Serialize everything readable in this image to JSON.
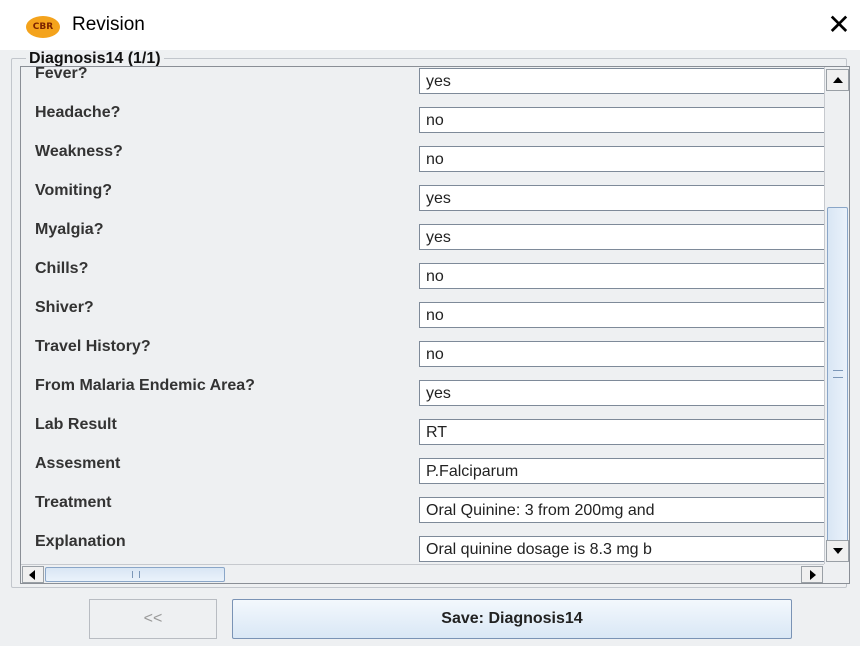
{
  "window": {
    "title": "Revision",
    "app_logo_text": "CBR",
    "close_glyph": "✕"
  },
  "group": {
    "legend": "Diagnosis14 (1/1)"
  },
  "fields": [
    {
      "label": "Fever?",
      "value": "yes"
    },
    {
      "label": "Headache?",
      "value": "no"
    },
    {
      "label": "Weakness?",
      "value": "no"
    },
    {
      "label": "Vomiting?",
      "value": "yes"
    },
    {
      "label": "Myalgia?",
      "value": "yes"
    },
    {
      "label": "Chills?",
      "value": "no"
    },
    {
      "label": "Shiver?",
      "value": "no"
    },
    {
      "label": "Travel History?",
      "value": "no"
    },
    {
      "label": "From Malaria Endemic Area?",
      "value": "yes"
    },
    {
      "label": "Lab Result",
      "value": "RT"
    },
    {
      "label": "Assesment",
      "value": "P.Falciparum"
    },
    {
      "label": "Treatment",
      "value": "Oral Quinine: 3 from 200mg and"
    },
    {
      "label": "Explanation",
      "value": "Oral quinine dosage is 8.3 mg b"
    }
  ],
  "buttons": {
    "prev_label": "<<",
    "save_label": "Save: Diagnosis14"
  }
}
